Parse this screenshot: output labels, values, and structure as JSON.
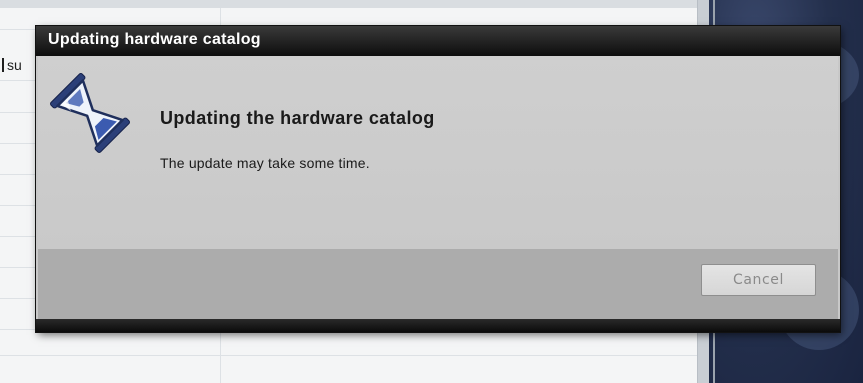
{
  "background": {
    "row_label_fragment": "su"
  },
  "dialog": {
    "title": "Updating hardware catalog",
    "heading": "Updating the hardware catalog",
    "message": "The update may take some time.",
    "icon": "hourglass-icon",
    "cancel_label": "Cancel",
    "cancel_enabled": false
  },
  "colors": {
    "titlebar": "#0d0d0d",
    "dialog_body": "#cfcfcf",
    "dialog_footer": "#acacac",
    "side_panel": "#24304d"
  }
}
